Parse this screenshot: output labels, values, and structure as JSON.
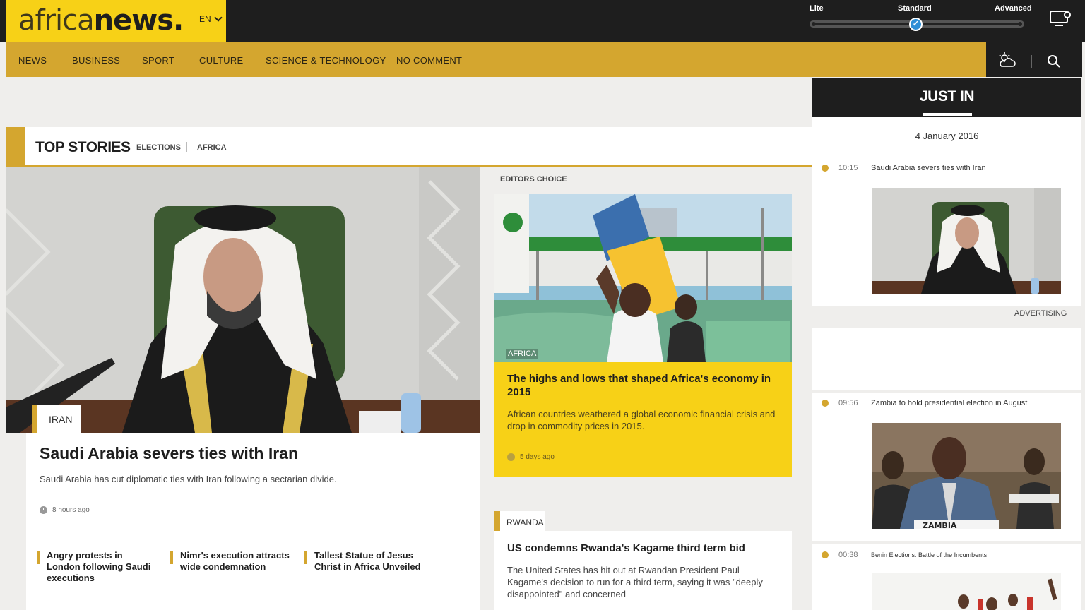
{
  "header": {
    "logo_prefix": "africa",
    "logo_suffix": "news.",
    "language": "EN",
    "modes": [
      "Lite",
      "Standard",
      "Advanced"
    ],
    "active_mode_check": "✓"
  },
  "nav": {
    "items": [
      "NEWS",
      "BUSINESS",
      "SPORT",
      "CULTURE",
      "SCIENCE & TECHNOLOGY",
      "NO COMMENT"
    ]
  },
  "top_stories": {
    "title": "TOP STORIES",
    "links": [
      "ELECTIONS",
      "AFRICA"
    ]
  },
  "main_story": {
    "tag": "IRAN",
    "title": "Saudi Arabia severs ties with Iran",
    "description": "Saudi Arabia has cut diplomatic ties with Iran following a sectarian divide.",
    "time": "8 hours ago",
    "related": [
      "Angry protests in London following Saudi executions",
      "Nimr's execution attracts wide condemnation",
      "Tallest Statue of Jesus Christ in Africa Unveiled"
    ]
  },
  "editors_choice": {
    "label": "EDITORS CHOICE",
    "category": "AFRICA",
    "title": "The highs and lows that shaped Africa's economy in 2015",
    "description": "African countries weathered a global economic financial crisis and drop in commodity prices in 2015.",
    "time": "5 days ago"
  },
  "rwanda_story": {
    "tag": "RWANDA",
    "title": "US condemns Rwanda's Kagame third term bid",
    "description": "The United States has hit out at Rwandan President Paul Kagame's decision to run for a third term, saying it was \"deeply disappointed\" and concerned"
  },
  "just_in": {
    "title": "JUST IN",
    "date": "4 January 2016",
    "advertising": "ADVERTISING",
    "items": [
      {
        "time": "10:15",
        "headline": "Saudi Arabia severs ties with Iran"
      },
      {
        "time": "09:56",
        "headline": "Zambia to hold presidential election in August",
        "image_caption": "ZAMBIA"
      },
      {
        "time": "00:38",
        "headline": "Benin Elections: Battle of the Incumbents"
      }
    ]
  },
  "colors": {
    "brand_yellow": "#f7d117",
    "brand_gold": "#d4a62f",
    "dark": "#1e1e1e"
  }
}
